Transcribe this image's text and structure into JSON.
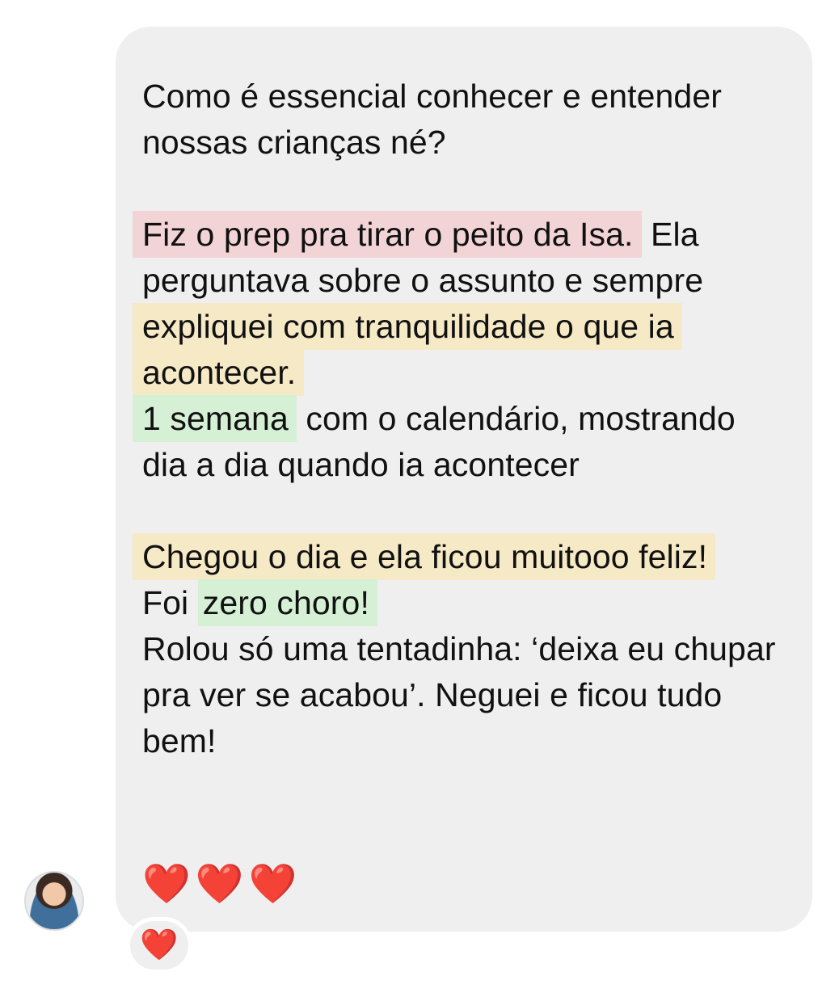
{
  "message": {
    "line1": "Como é essencial conhecer e entender nossas crianças né?",
    "para2_highlight": "Fiz o prep pra tirar o peito da Isa.",
    "para2_rest": " Ela perguntava sobre o assunto e sempre ",
    "para2_highlight2": "expliquei com tranquilidade o que ia acontecer.",
    "para3_highlight": "1 semana",
    "para3_rest": " com o calendário, mostrando dia a dia quando ia acontecer",
    "para4_highlight": "Chegou o dia e ela ficou muitooo feliz!",
    "para5_prefix": "Foi ",
    "para5_highlight": "zero choro!",
    "para6": "Rolou só uma tentadinha: ‘deixa eu chupar pra ver se acabou’. Neguei e ficou tudo bem!",
    "hearts": "❤️❤️❤️"
  },
  "reaction": {
    "emoji": "❤️"
  },
  "avatar": {
    "icon": "user-avatar"
  },
  "colors": {
    "bubble": "#efefef",
    "highlight_red": "#f2d4d6",
    "highlight_yellow": "#f6e9c5",
    "highlight_green": "#d5f0d5",
    "heart": "#e0242b"
  }
}
